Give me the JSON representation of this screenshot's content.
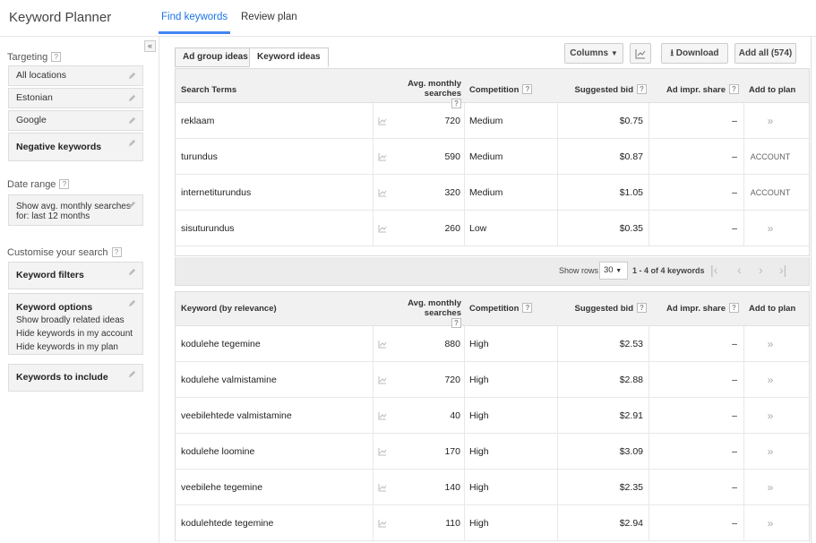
{
  "app": {
    "title": "Keyword Planner"
  },
  "nav": {
    "find": "Find keywords",
    "review": "Review plan"
  },
  "sidebar": {
    "collapse": "«",
    "targeting_label": "Targeting",
    "location": "All locations",
    "language": "Estonian",
    "network": "Google",
    "negative": "Negative keywords",
    "date_label": "Date range",
    "date_line1": "Show avg. monthly searches",
    "date_line2": "for: last 12 months",
    "customise_label": "Customise your search",
    "keyword_filters": "Keyword filters",
    "keyword_options": "Keyword options",
    "options": [
      "Show broadly related ideas",
      "Hide keywords in my account",
      "Hide keywords in my plan"
    ],
    "keywords_include": "Keywords to include",
    "help": "?"
  },
  "tabs": {
    "ad_group": "Ad group ideas",
    "keyword": "Keyword ideas"
  },
  "toolbar": {
    "columns": "Columns",
    "download": "Download",
    "add_all": "Add all (574)"
  },
  "table1": {
    "headers": {
      "term": "Search Terms",
      "searches": "Avg. monthly searches",
      "competition": "Competition",
      "bid": "Suggested bid",
      "impr": "Ad impr. share",
      "add": "Add to plan"
    },
    "rows": [
      {
        "term": "reklaam",
        "searches": "720",
        "competition": "Medium",
        "bid": "$0.75",
        "impr": "–",
        "add": "»"
      },
      {
        "term": "turundus",
        "searches": "590",
        "competition": "Medium",
        "bid": "$0.87",
        "impr": "–",
        "add": "ACCOUNT"
      },
      {
        "term": "internetiturundus",
        "searches": "320",
        "competition": "Medium",
        "bid": "$1.05",
        "impr": "–",
        "add": "ACCOUNT"
      },
      {
        "term": "sisuturundus",
        "searches": "260",
        "competition": "Low",
        "bid": "$0.35",
        "impr": "–",
        "add": "»"
      }
    ]
  },
  "pager": {
    "show_rows": "Show rows",
    "rows_value": "30",
    "range": "1 - 4 of 4 keywords"
  },
  "table2": {
    "headers": {
      "term": "Keyword (by relevance)",
      "searches": "Avg. monthly searches",
      "competition": "Competition",
      "bid": "Suggested bid",
      "impr": "Ad impr. share",
      "add": "Add to plan"
    },
    "rows": [
      {
        "term": "kodulehe tegemine",
        "searches": "880",
        "competition": "High",
        "bid": "$2.53",
        "impr": "–",
        "add": "»"
      },
      {
        "term": "kodulehe valmistamine",
        "searches": "720",
        "competition": "High",
        "bid": "$2.88",
        "impr": "–",
        "add": "»"
      },
      {
        "term": "veebilehtede valmistamine",
        "searches": "40",
        "competition": "High",
        "bid": "$2.91",
        "impr": "–",
        "add": "»"
      },
      {
        "term": "kodulehe loomine",
        "searches": "170",
        "competition": "High",
        "bid": "$3.09",
        "impr": "–",
        "add": "»"
      },
      {
        "term": "veebilehe tegemine",
        "searches": "140",
        "competition": "High",
        "bid": "$2.35",
        "impr": "–",
        "add": "»"
      },
      {
        "term": "kodulehtede tegemine",
        "searches": "110",
        "competition": "High",
        "bid": "$2.94",
        "impr": "–",
        "add": "»"
      }
    ]
  }
}
